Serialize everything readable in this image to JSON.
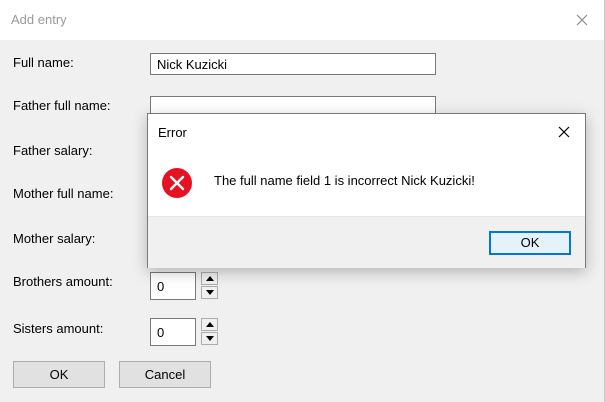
{
  "window": {
    "title": "Add entry",
    "close_icon": "close-icon"
  },
  "form": {
    "full_name_label": "Full name:",
    "full_name_value": "Nick Kuzicki",
    "father_full_name_label": "Father full name:",
    "father_full_name_value": "",
    "father_salary_label": "Father salary:",
    "mother_full_name_label": "Mother full name:",
    "mother_salary_label": "Mother salary:",
    "brothers_amount_label": "Brothers amount:",
    "brothers_amount_value": "0",
    "sisters_amount_label": "Sisters amount:",
    "sisters_amount_value": "0",
    "ok_label": "OK",
    "cancel_label": "Cancel"
  },
  "error_dialog": {
    "title": "Error",
    "message": "The full name field 1 is incorrect Nick Kuzicki!",
    "ok_label": "OK",
    "icon": "error-icon",
    "icon_color": "#e81123",
    "accent_color": "#0078d7"
  }
}
